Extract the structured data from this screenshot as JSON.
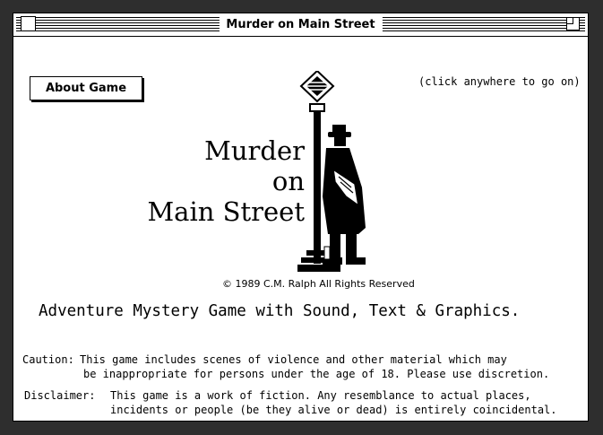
{
  "window": {
    "title": "Murder on Main Street"
  },
  "about_button": {
    "label": "About Game"
  },
  "click_hint": "(click anywhere to go on)",
  "game_title": {
    "line1": "Murder",
    "line2": "on",
    "line3": "Main Street"
  },
  "copyright": "© 1989 C.M. Ralph  All Rights Reserved",
  "tagline": "Adventure Mystery Game with Sound, Text & Graphics.",
  "caution": {
    "label": "Caution:",
    "line1": "This game includes scenes of violence and other material which may",
    "line2": "be inappropriate for persons under the age of 18. Please use discretion."
  },
  "disclaimer": {
    "label": "Disclaimer:",
    "line1": "This game is a work of fiction. Any resemblance to actual places,",
    "line2": "incidents or people (be they alive or dead) is entirely coincidental."
  },
  "icons": [
    "close-box-icon",
    "zoom-box-icon",
    "lamppost-detective-illustration"
  ],
  "colors": {
    "background": "#2e2e2e",
    "window": "#ffffff",
    "ink": "#000000"
  }
}
